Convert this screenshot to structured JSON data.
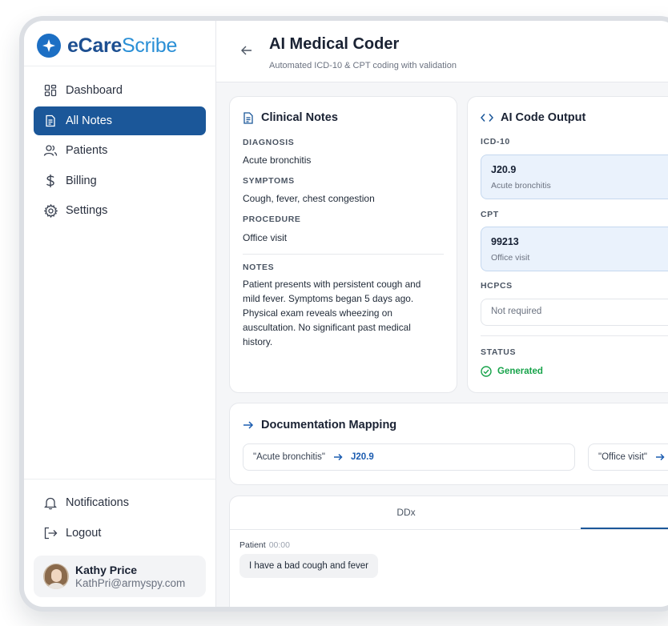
{
  "brand": {
    "name_bold": "eCare",
    "name_light": "Scribe"
  },
  "sidebar": {
    "items": [
      {
        "label": "Dashboard",
        "icon": "dashboard-icon"
      },
      {
        "label": "All Notes",
        "icon": "notes-icon",
        "active": true
      },
      {
        "label": "Patients",
        "icon": "patients-icon"
      },
      {
        "label": "Billing",
        "icon": "dollar-icon"
      },
      {
        "label": "Settings",
        "icon": "gear-icon"
      }
    ],
    "bottom": [
      {
        "label": "Notifications",
        "icon": "bell-icon"
      },
      {
        "label": "Logout",
        "icon": "logout-icon"
      }
    ],
    "user": {
      "name": "Kathy Price",
      "email": "KathPri@armyspy.com"
    }
  },
  "header": {
    "title": "AI Medical Coder",
    "subtitle": "Automated ICD-10 & CPT coding with validation"
  },
  "clinical_notes": {
    "title": "Clinical Notes",
    "fields": [
      {
        "label": "DIAGNOSIS",
        "value": "Acute bronchitis"
      },
      {
        "label": "SYMPTOMS",
        "value": "Cough, fever, chest congestion"
      },
      {
        "label": "PROCEDURE",
        "value": "Office visit"
      }
    ],
    "notes_label": "NOTES",
    "notes_text": "Patient presents with persistent cough and mild fever. Symptoms began 5 days ago. Physical exam reveals wheezing on auscultation. No significant past medical history."
  },
  "code_output": {
    "title": "AI Code Output",
    "icd_label": "ICD-10",
    "icd": {
      "code": "J20.9",
      "desc": "Acute bronchitis"
    },
    "cpt_label": "CPT",
    "cpt": {
      "code": "99213",
      "desc": "Office visit"
    },
    "hcpcs_label": "HCPCS",
    "hcpcs_value": "Not required",
    "status_label": "STATUS",
    "status_value": "Generated"
  },
  "mapping": {
    "title": "Documentation Mapping",
    "items": [
      {
        "phrase": "\"Acute bronchitis\"",
        "code": "J20.9"
      },
      {
        "phrase": "\"Office visit\"",
        "code": ""
      }
    ]
  },
  "conversation": {
    "tab_ddx": "DDx",
    "speaker": "Patient",
    "time": "00:00",
    "message": "I have a bad cough and fever"
  },
  "colors": {
    "accent": "#1b5799",
    "code_bg": "#eaf2fc",
    "success": "#17a34a"
  }
}
